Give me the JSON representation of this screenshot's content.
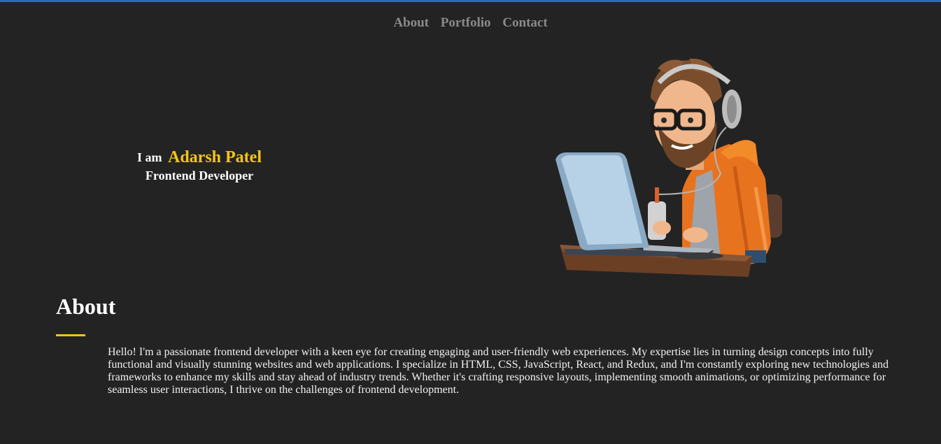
{
  "colors": {
    "background": "#232323",
    "accent": "#f4c518",
    "nav_link": "#8a8a8a",
    "top_border": "#2f66c3"
  },
  "nav": {
    "items": [
      {
        "label": "About"
      },
      {
        "label": "Portfolio"
      },
      {
        "label": "Contact"
      }
    ]
  },
  "hero": {
    "prefix": "I am",
    "name": "Adarsh Patel",
    "role": "Frontend Developer",
    "illustration_icon": "developer-with-laptop-illustration"
  },
  "about": {
    "heading": "About",
    "text": "Hello! I'm a passionate frontend developer with a keen eye for creating engaging and user-friendly web experiences. My expertise lies in turning design concepts into fully functional and visually stunning websites and web applications. I specialize in HTML, CSS, JavaScript, React, and Redux, and I'm constantly exploring new technologies and frameworks to enhance my skills and stay ahead of industry trends. Whether it's crafting responsive layouts, implementing smooth animations, or optimizing performance for seamless user interactions, I thrive on the challenges of frontend development."
  }
}
